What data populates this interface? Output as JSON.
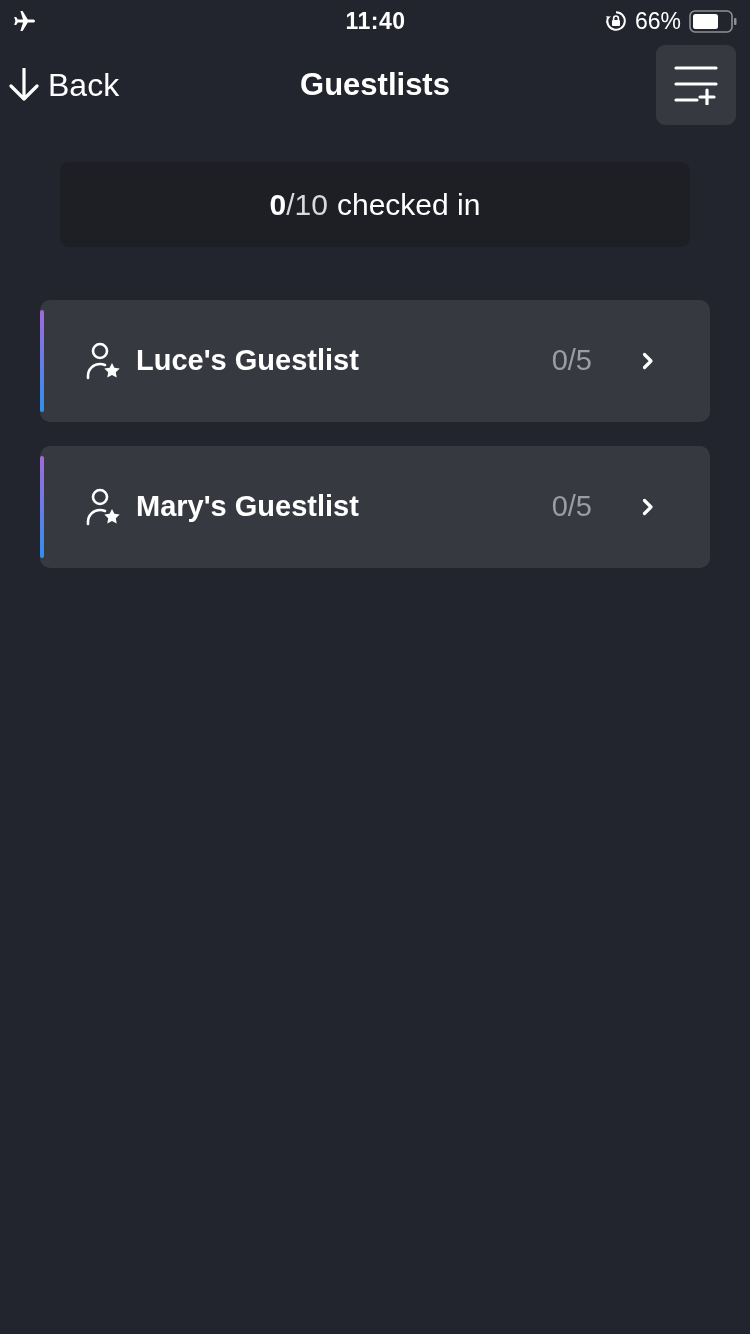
{
  "status_bar": {
    "time": "11:40",
    "battery": "66%"
  },
  "nav": {
    "back": "Back",
    "title": "Guestlists"
  },
  "summary": {
    "checked": "0",
    "total": "/10",
    "label": "checked in"
  },
  "guestlists": [
    {
      "name": "Luce's Guestlist",
      "count": "0/5"
    },
    {
      "name": "Mary's Guestlist",
      "count": "0/5"
    }
  ]
}
